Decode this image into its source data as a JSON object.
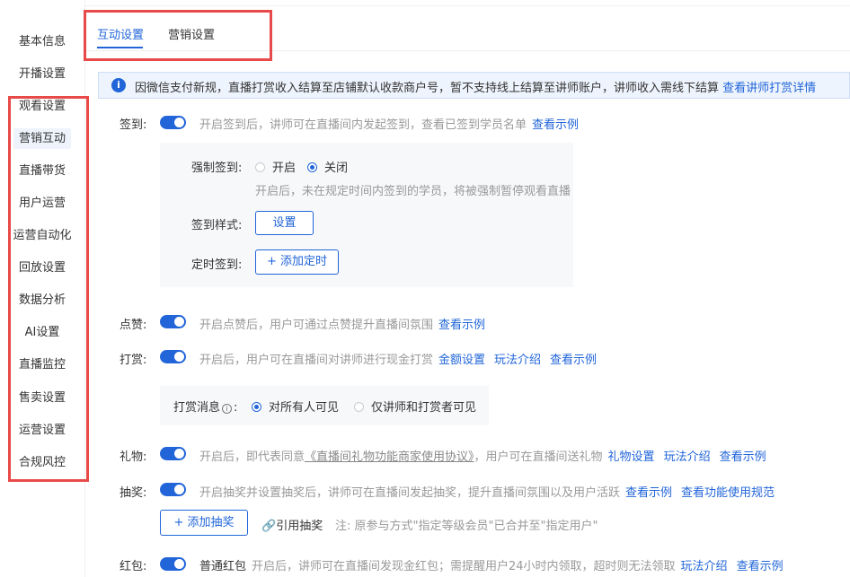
{
  "sidebar": {
    "items": [
      {
        "label": "基本信息"
      },
      {
        "label": "开播设置"
      },
      {
        "label": "观看设置"
      },
      {
        "label": "营销互动"
      },
      {
        "label": "直播带货"
      },
      {
        "label": "用户运营"
      },
      {
        "label": "运营自动化"
      },
      {
        "label": "回放设置"
      },
      {
        "label": "数据分析"
      },
      {
        "label": "AI设置"
      },
      {
        "label": "直播监控"
      },
      {
        "label": "售卖设置"
      },
      {
        "label": "运营设置"
      },
      {
        "label": "合规风控"
      }
    ],
    "active_index": 3
  },
  "tabs": [
    {
      "label": "互动设置",
      "active": true
    },
    {
      "label": "营销设置",
      "active": false
    }
  ],
  "notice": {
    "icon": "info-icon",
    "text": "因微信支付新规，直播打赏收入结算至店铺默认收款商户号，暂不支持线上结算至讲师账户，讲师收入需线下结算",
    "link": "查看讲师打赏详情"
  },
  "signin": {
    "label": "签到:",
    "enabled": true,
    "desc": "开启签到后，讲师可在直播间内发起签到，查看已签到学员名单",
    "example_link": "查看示例",
    "force_label": "强制签到:",
    "force_on": "开启",
    "force_off": "关闭",
    "force_value": "关闭",
    "force_desc": "开启后，未在规定时间内签到的学员，将被强制暂停观看直播",
    "style_label": "签到样式:",
    "style_button": "设置",
    "timed_label": "定时签到:",
    "timed_button": "+ 添加定时"
  },
  "like": {
    "label": "点赞:",
    "enabled": true,
    "desc": "开启点赞后，用户可通过点赞提升直播间氛围",
    "example_link": "查看示例"
  },
  "tip": {
    "label": "打赏:",
    "enabled": true,
    "desc": "开启后，用户可在直播间对讲师进行现金打赏",
    "links": [
      "金额设置",
      "玩法介绍",
      "查看示例"
    ],
    "msg_label": "打赏消息",
    "msg_opt_all": "对所有人可见",
    "msg_opt_limited": "仅讲师和打赏者可见",
    "msg_value": "对所有人可见"
  },
  "gift": {
    "label": "礼物:",
    "enabled": true,
    "desc_pre": "开启后，即代表同意",
    "agreement": "《直播间礼物功能商家使用协议》",
    "desc_post": "，用户可在直播间送礼物",
    "links": [
      "礼物设置",
      "玩法介绍",
      "查看示例"
    ]
  },
  "lottery": {
    "label": "抽奖:",
    "enabled": true,
    "desc": "开启抽奖并设置抽奖后，讲师可在直播间发起抽奖，提升直播间氛围以及用户活跃",
    "links": [
      "查看示例",
      "查看功能使用规范"
    ],
    "add_button": "+ 添加抽奖",
    "ref_link": "引用抽奖",
    "note": "注: 原参与方式\"指定等级会员\"已合并至\"指定用户\""
  },
  "redpacket": {
    "label": "红包:",
    "enabled": true,
    "type": "普通红包",
    "desc": "开启后，讲师可在直播间发现金红包；需提醒用户24小时内领取，超时则无法领取",
    "links": [
      "玩法介绍",
      "查看示例"
    ]
  },
  "colors": {
    "accent": "#2165d9",
    "highlight_box": "#e84a4a",
    "notice_bg": "#eef4fd"
  }
}
